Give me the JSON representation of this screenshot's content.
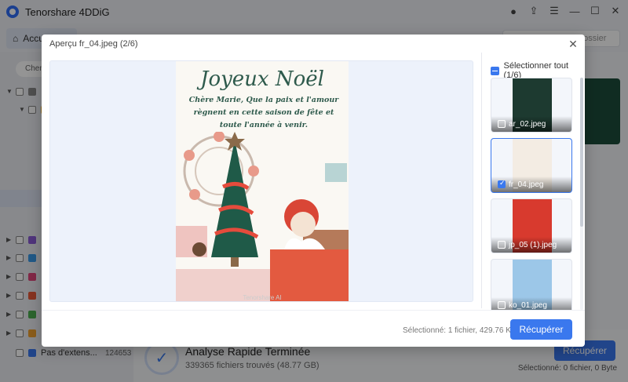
{
  "app": {
    "title": "Tenorshare 4DDiG"
  },
  "nav": {
    "home_label": "Accueil",
    "search_placeholder": "dossier"
  },
  "sidebar": {
    "chip_label": "Chem",
    "last_item_label": "Pas d'extens...",
    "last_item_count": "124653"
  },
  "status": {
    "title": "Analyse Rapide Terminée",
    "subtitle": "339365 fichiers trouvés (48.77 GB)",
    "recover_label": "Récupérer",
    "selected": "Sélectionné: 0 fichier, 0 Byte"
  },
  "dialog": {
    "title": "Aperçu fr_04.jpeg (2/6)",
    "select_all": "Sélectionner tout (1/6)",
    "selected": "Sélectionné: 1 fichier, 429.76 KB",
    "recover_label": "Récupérer",
    "card": {
      "title": "Joyeux Noël",
      "text": "Chère Marie, Que la paix et l'amour règnent en cette saison de fête et toute l'année à venir.",
      "brand": "Tenorshare AI"
    },
    "thumbnails": [
      {
        "name": "ar_02.jpeg",
        "checked": false
      },
      {
        "name": "fr_04.jpeg",
        "checked": true
      },
      {
        "name": "jp_05 (1).jpeg",
        "checked": false
      },
      {
        "name": "ko_01.jpeg",
        "checked": false
      }
    ]
  },
  "colors": {
    "accent": "#3a78ee",
    "card_green": "#2e5a4c"
  }
}
